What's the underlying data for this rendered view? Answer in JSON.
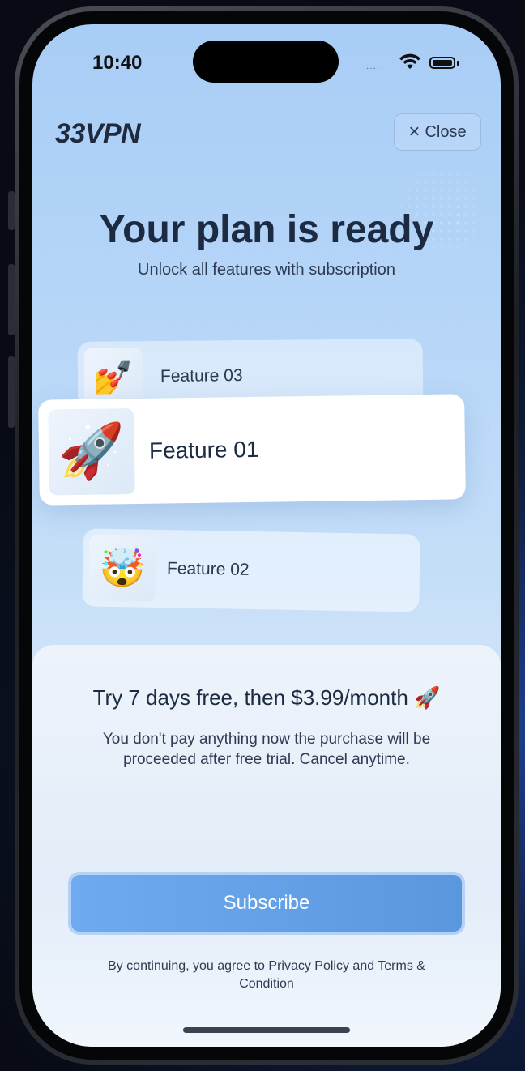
{
  "status_bar": {
    "time": "10:40",
    "signal": "....",
    "wifi_icon": "wifi-icon",
    "battery_icon": "battery-icon"
  },
  "header": {
    "logo": "33VPN",
    "close_icon": "×",
    "close_label": "Close"
  },
  "hero": {
    "title": "Your plan is ready",
    "subtitle": "Unlock all features with subscription"
  },
  "features": [
    {
      "label": "Feature 03",
      "icon": "💅"
    },
    {
      "label": "Feature 01",
      "icon": "🚀"
    },
    {
      "label": "Feature 02",
      "icon": "🤯"
    }
  ],
  "offer": {
    "headline": "Try 7 days free, then $3.99/month 🚀",
    "description": "You don't pay anything now the purchase will be proceeded after free trial. Cancel anytime."
  },
  "cta": {
    "subscribe_label": "Subscribe"
  },
  "legal": {
    "text": "By continuing, you agree to Privacy Policy and Terms & Condition"
  },
  "colors": {
    "accent": "#5a97df",
    "title_text": "#1c2b42",
    "background_top": "#a8cdf6"
  }
}
